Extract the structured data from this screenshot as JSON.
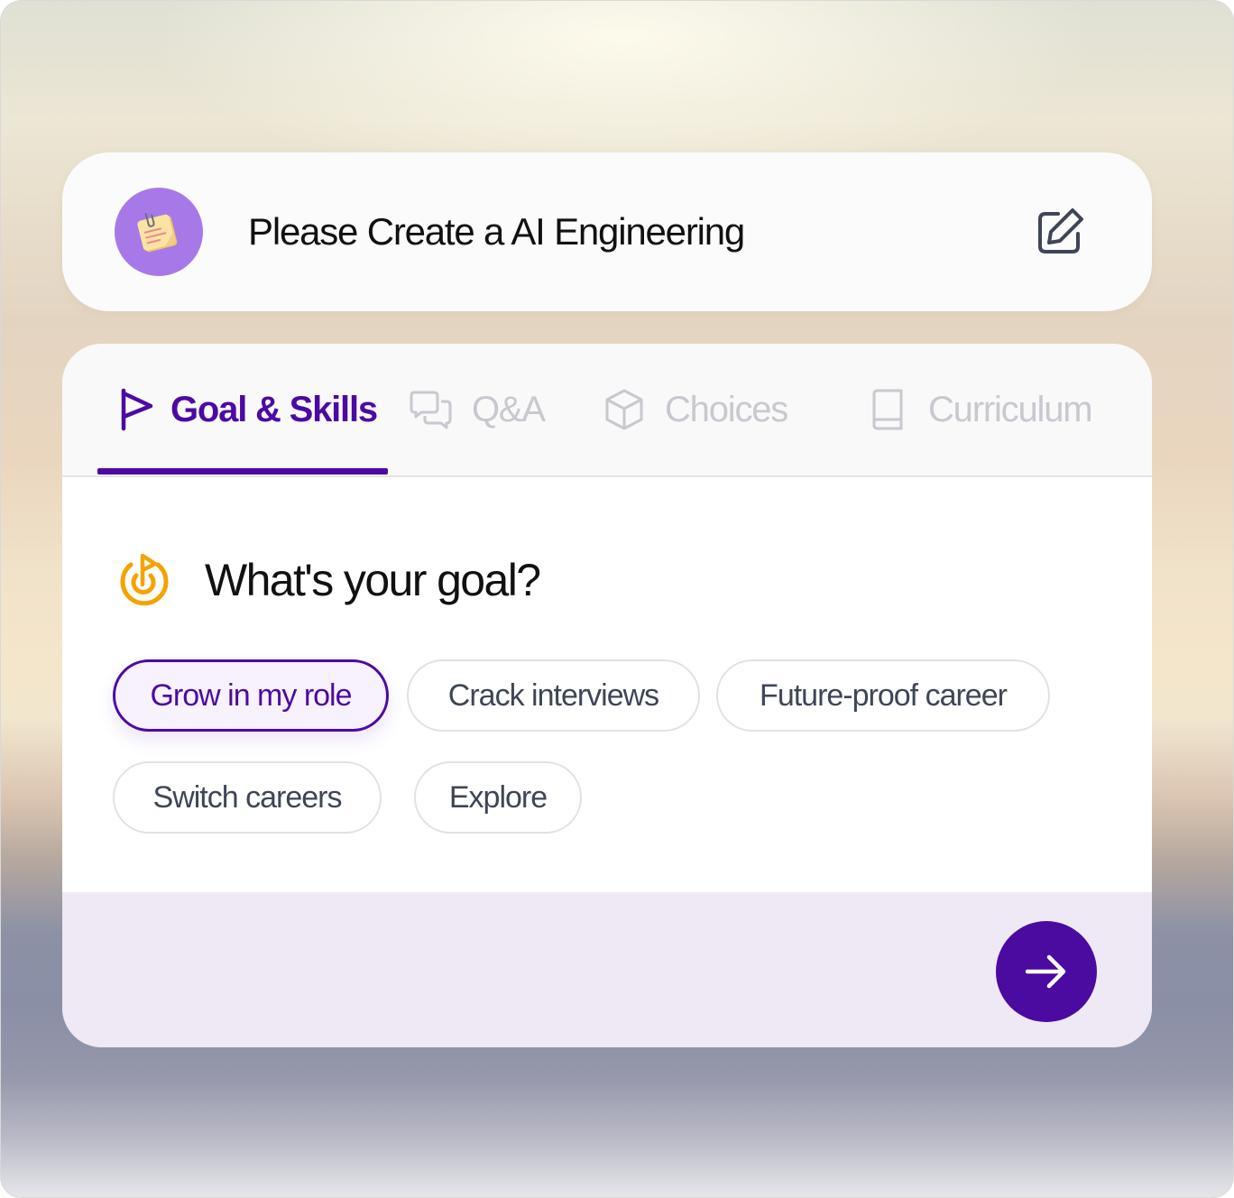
{
  "prompt": {
    "avatar_icon": "sticky-note-icon",
    "text": "Please Create a AI Engineering",
    "edit_icon": "edit-icon"
  },
  "tabs": [
    {
      "label": "Goal & Skills",
      "icon": "flag-icon",
      "active": true
    },
    {
      "label": "Q&A",
      "icon": "chat-bubbles-icon",
      "active": false
    },
    {
      "label": "Choices",
      "icon": "cube-icon",
      "active": false
    },
    {
      "label": "Curriculum",
      "icon": "book-icon",
      "active": false
    }
  ],
  "question": {
    "icon": "goal-target-icon",
    "text": "What's your goal?"
  },
  "options": [
    {
      "label": "Grow in my role",
      "selected": true
    },
    {
      "label": "Crack interviews",
      "selected": false
    },
    {
      "label": "Future-proof career",
      "selected": false
    },
    {
      "label": "Switch careers",
      "selected": false
    },
    {
      "label": "Explore",
      "selected": false
    }
  ],
  "next_button": {
    "icon": "arrow-right-icon"
  },
  "colors": {
    "accent": "#4c0aa3",
    "avatar": "#a779e8",
    "goal_icon": "#f5a300",
    "inactive_tab": "#c8c8cf",
    "footer": "#efe8f5"
  }
}
